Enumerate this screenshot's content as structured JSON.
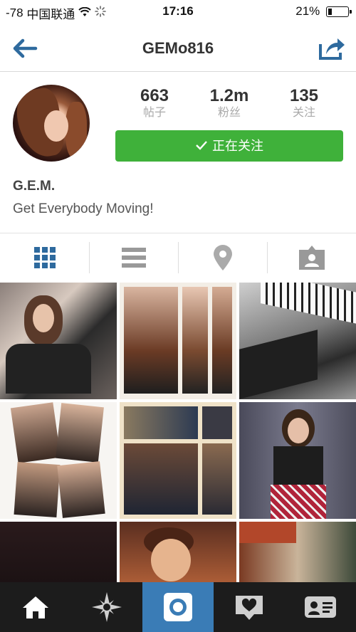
{
  "status_bar": {
    "signal": "-78",
    "carrier": "中国联通",
    "time": "17:16",
    "battery_percent": "21%",
    "battery_level": 0.21
  },
  "nav": {
    "title": "GEMo816",
    "back_icon": "back-arrow-icon",
    "share_icon": "share-icon"
  },
  "profile": {
    "stats": [
      {
        "value": "663",
        "label": "帖子"
      },
      {
        "value": "1.2m",
        "label": "粉丝"
      },
      {
        "value": "135",
        "label": "关注"
      }
    ],
    "follow_button": "正在关注",
    "display_name": "G.E.M.",
    "bio": "Get Everybody Moving!"
  },
  "view_tabs": [
    {
      "name": "grid-view-icon",
      "active": true
    },
    {
      "name": "list-view-icon",
      "active": false
    },
    {
      "name": "location-pin-icon",
      "active": false
    },
    {
      "name": "tagged-photos-icon",
      "active": false
    }
  ],
  "bottom_tabs": [
    {
      "name": "home-icon"
    },
    {
      "name": "explore-icon"
    },
    {
      "name": "camera-icon"
    },
    {
      "name": "activity-heart-icon"
    },
    {
      "name": "profile-icon"
    }
  ],
  "colors": {
    "follow_green": "#3fb13a",
    "active_blue": "#2f6a9b",
    "tabbar_dark": "#1c1c1c"
  }
}
